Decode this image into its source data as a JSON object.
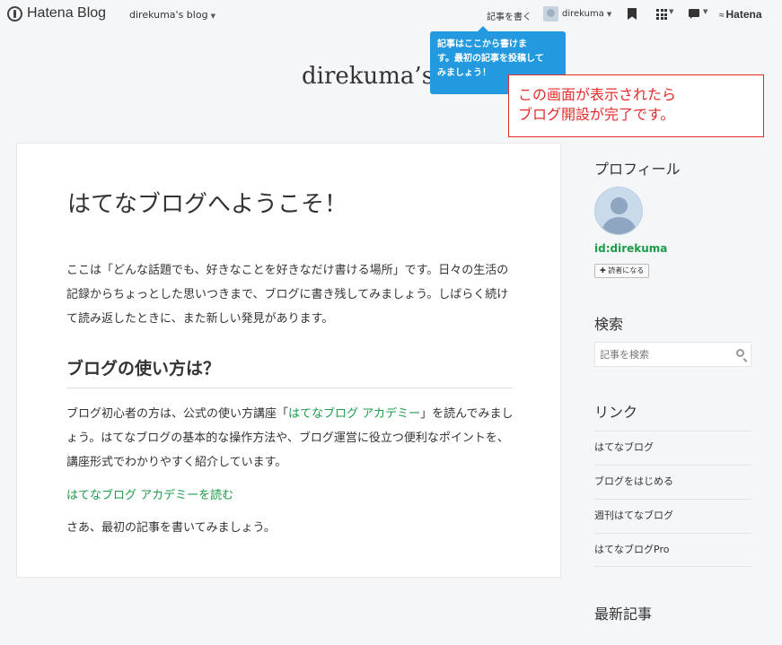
{
  "header": {
    "logo_text": "Hatena Blog",
    "blog_menu": "direkuma's blog",
    "write_label": "記事を書く",
    "user_label": "direkuma",
    "hatena_label": "Hatena"
  },
  "tooltip": {
    "lines": [
      "記事はここから書けま",
      "す。最初の記事を投稿して",
      "みましょう！"
    ]
  },
  "blog_title": "direkuma’s blog",
  "annotation": {
    "line1": "この画面が表示されたら",
    "line2": "ブログ開設が完了です。"
  },
  "entry": {
    "title": "はてなブログへようこそ！",
    "p1": "ここは「どんな話題でも、好きなことを好きなだけ書ける場所」です。日々の生活の記録からちょっとした思いつきまで、ブログに書き残してみましょう。しばらく続けて読み返したときに、また新しい発見があります。",
    "h2": "ブログの使い方は？",
    "p2_before": "ブログ初心者の方は、公式の使い方講座「",
    "p2_link": "はてなブログ アカデミー",
    "p2_after": "」を読んでみましょう。はてなブログの基本的な操作方法や、ブログ運営に役立つ便利なポイントを、講座形式でわかりやすく紹介しています。",
    "academy_link": "はてなブログ アカデミーを読む",
    "p3": "さあ、最初の記事を書いてみましょう。"
  },
  "sidebar": {
    "profile_heading": "プロフィール",
    "profile_id": "id:direkuma",
    "reader_button": "読者になる",
    "search_heading": "検索",
    "search_placeholder": "記事を検索",
    "links_heading": "リンク",
    "links": [
      "はてなブログ",
      "ブログをはじめる",
      "週刊はてなブログ",
      "はてなブログPro"
    ],
    "recent_heading": "最新記事"
  }
}
